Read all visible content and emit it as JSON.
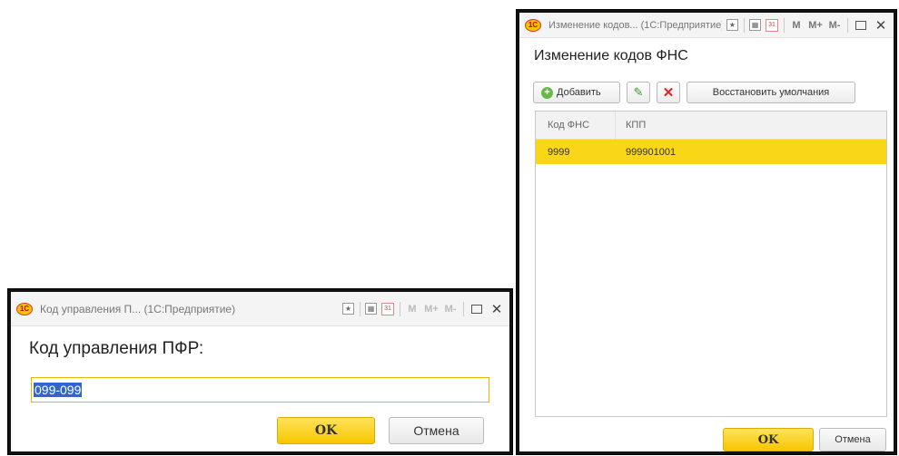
{
  "windows": {
    "pfr": {
      "title": "Код управления П... (1С:Предприятие)",
      "heading": "Код управления ПФР:",
      "input_value": "099-099",
      "ok_label": "OK",
      "cancel_label": "Отмена"
    },
    "fns": {
      "title": "Изменение кодов... (1С:Предприятие)",
      "heading": "Изменение кодов ФНС",
      "toolbar": {
        "add_label": "Добавить",
        "restore_label": "Восстановить умолчания"
      },
      "table": {
        "columns": [
          "Код ФНС",
          "КПП"
        ],
        "rows": [
          [
            "9999",
            "999901001"
          ]
        ]
      },
      "ok_label": "OK",
      "cancel_label": "Отмена"
    }
  },
  "titlebar_buttons": {
    "logo": "1С",
    "calendar": "31",
    "m": "M",
    "m_plus": "M+",
    "m_minus": "M-",
    "close": "✕"
  },
  "colors": {
    "accent_yellow": "#f6c600",
    "selected_row": "#f9d616",
    "selection_blue": "#3366cc"
  }
}
